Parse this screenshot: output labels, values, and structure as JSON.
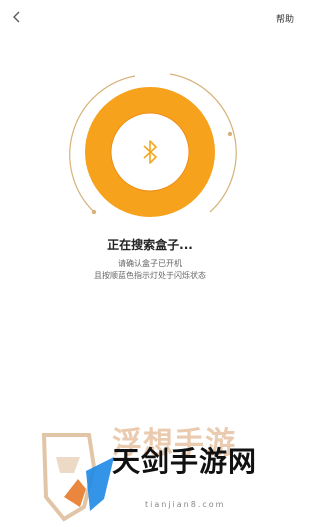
{
  "header": {
    "help_label": "帮助"
  },
  "status": {
    "title": "正在搜索盒子...",
    "hint_line1": "请确认盒子已开机",
    "hint_line2": "且按顺蓝色指示灯处于闪烁状态"
  },
  "watermark": {
    "brand": "天剑手游网",
    "back_text": "浮想手游",
    "domain": "tianjian8.com"
  },
  "colors": {
    "ring_orange": "#F7A21C",
    "ring_orange_dark": "#F08C12",
    "bluetooth_icon": "#F5A623",
    "outer_arc": "#D6B27A"
  },
  "icons": {
    "back": "chevron-left-icon",
    "center": "bluetooth-icon"
  }
}
